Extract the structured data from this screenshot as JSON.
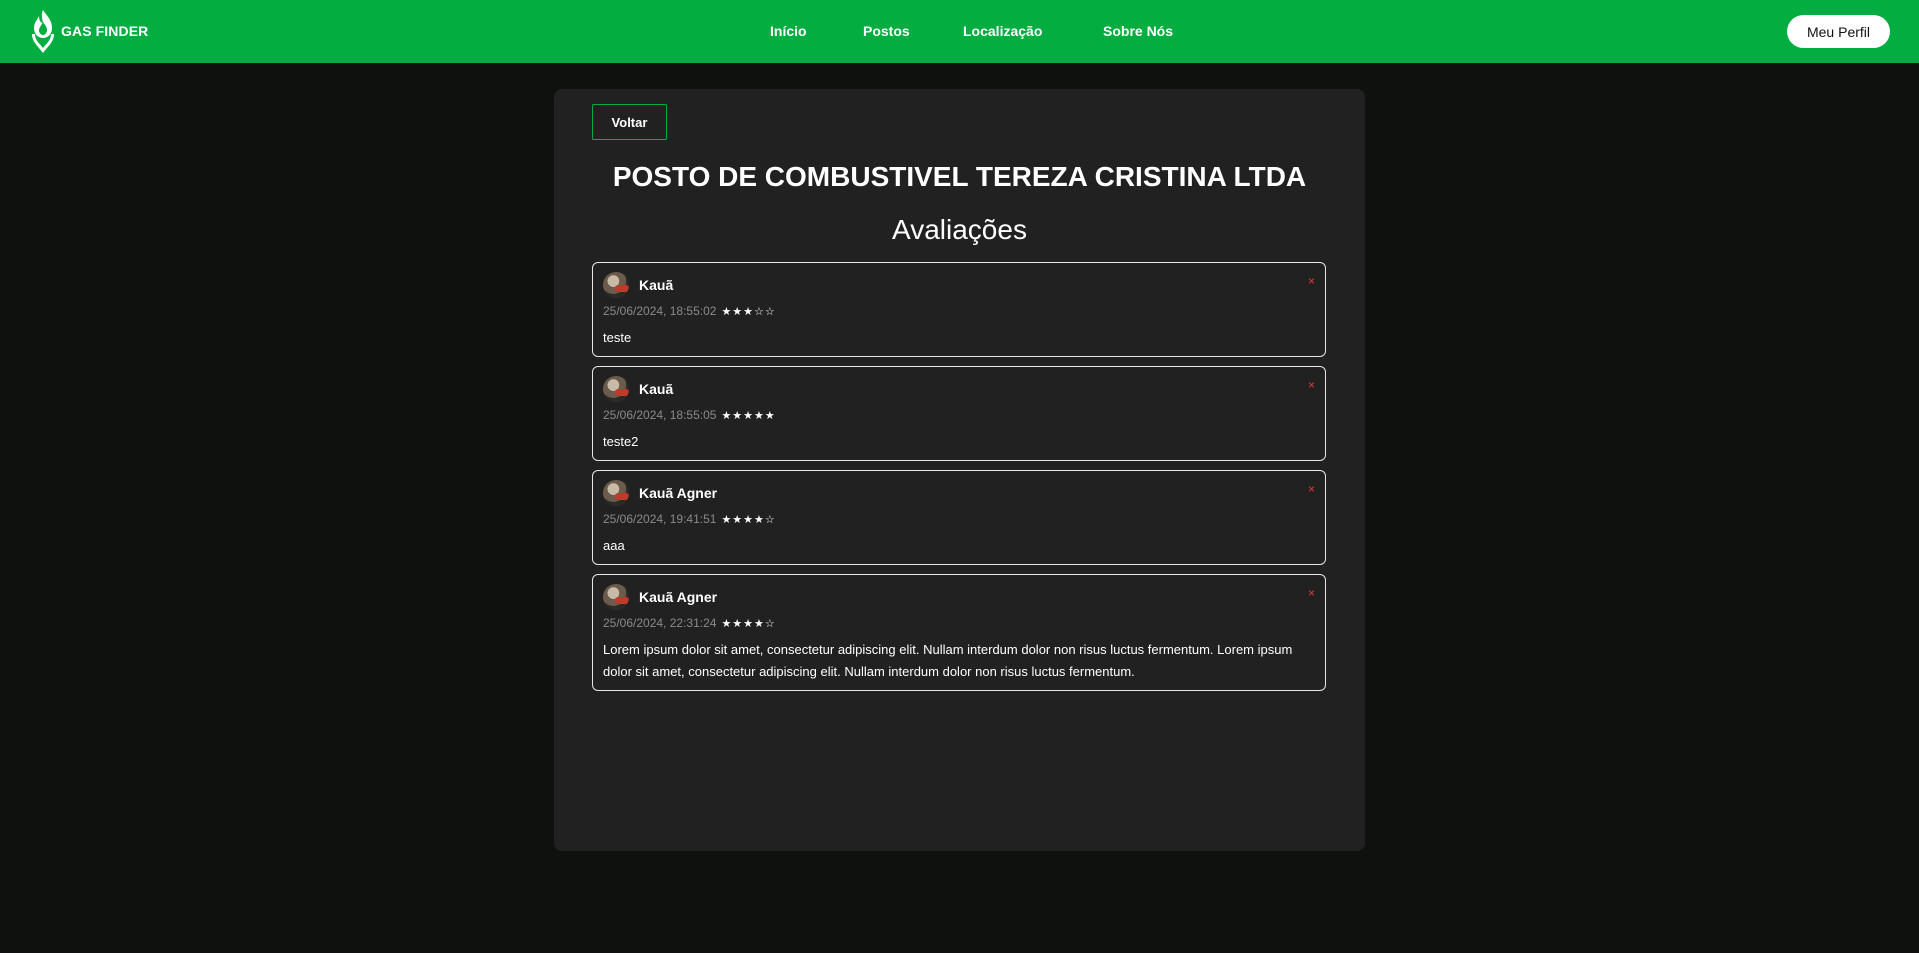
{
  "brand": {
    "name": "GAS FINDER",
    "icon": "flame-pin-icon"
  },
  "nav": {
    "links": [
      "Início",
      "Postos",
      "Localização",
      "Sobre Nós"
    ],
    "profile_label": "Meu Perfil"
  },
  "page": {
    "back_label": "Voltar",
    "station_name": "POSTO DE COMBUSTIVEL TEREZA CRISTINA LTDA",
    "section_title": "Avaliações"
  },
  "reviews": [
    {
      "author": "Kauã",
      "date": "25/06/2024, 18:55:02",
      "rating": 3,
      "stars": "★★★☆☆",
      "comment": "teste",
      "delete": "×"
    },
    {
      "author": "Kauã",
      "date": "25/06/2024, 18:55:05",
      "rating": 5,
      "stars": "★★★★★",
      "comment": "teste2",
      "delete": "×"
    },
    {
      "author": "Kauã Agner",
      "date": "25/06/2024, 19:41:51",
      "rating": 4,
      "stars": "★★★★☆",
      "comment": "aaa",
      "delete": "×"
    },
    {
      "author": "Kauã Agner",
      "date": "25/06/2024, 22:31:24",
      "rating": 4,
      "stars": "★★★★☆",
      "comment": "Lorem ipsum dolor sit amet, consectetur adipiscing elit. Nullam interdum dolor non risus luctus fermentum. Lorem ipsum dolor sit amet, consectetur adipiscing elit. Nullam interdum dolor non risus luctus fermentum.",
      "delete": "×"
    }
  ],
  "colors": {
    "brand_green": "#04ad40",
    "background": "#0f110f",
    "panel": "#212121",
    "delete_red": "#e53935"
  }
}
